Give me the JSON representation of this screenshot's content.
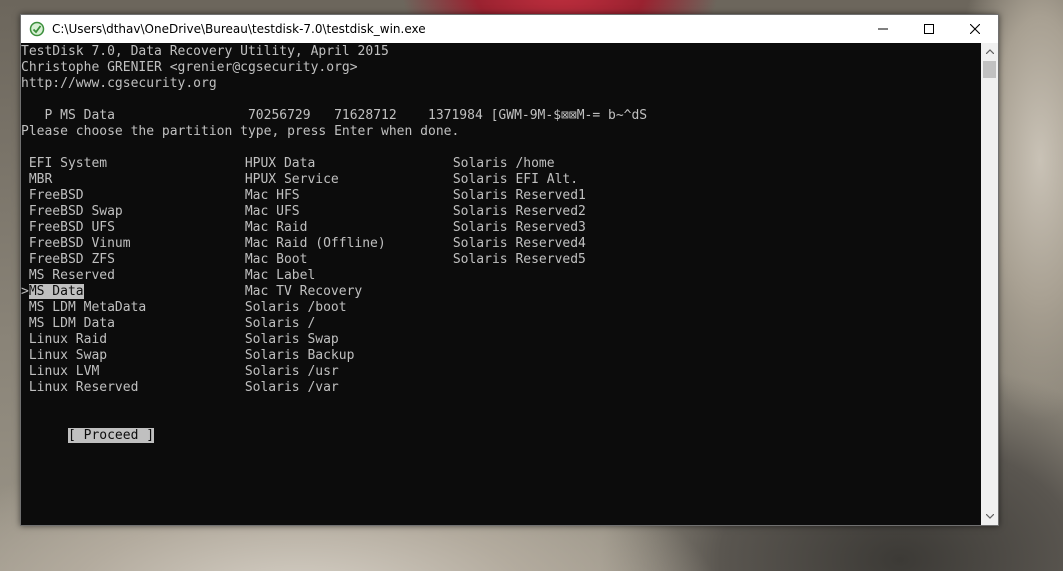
{
  "window": {
    "title": "C:\\Users\\dthav\\OneDrive\\Bureau\\testdisk-7.0\\testdisk_win.exe"
  },
  "console": {
    "header": [
      "TestDisk 7.0, Data Recovery Utility, April 2015",
      "Christophe GRENIER <grenier@cgsecurity.org>",
      "http://www.cgsecurity.org"
    ],
    "partition_line": "   P MS Data                 70256729   71628712    1371984 [GWM-9M-$⊠⊠M-= b~^dS",
    "prompt": "Please choose the partition type, press Enter when done.",
    "types_col1": [
      "EFI System",
      "MBR",
      "FreeBSD",
      "FreeBSD Swap",
      "FreeBSD UFS",
      "FreeBSD Vinum",
      "FreeBSD ZFS",
      "MS Reserved",
      "MS Data",
      "MS LDM MetaData",
      "MS LDM Data",
      "Linux Raid",
      "Linux Swap",
      "Linux LVM",
      "Linux Reserved"
    ],
    "types_col2": [
      "HPUX Data",
      "HPUX Service",
      "Mac HFS",
      "Mac UFS",
      "Mac Raid",
      "Mac Raid (Offline)",
      "Mac Boot",
      "Mac Label",
      "Mac TV Recovery",
      "Solaris /boot",
      "Solaris /",
      "Solaris Swap",
      "Solaris Backup",
      "Solaris /usr",
      "Solaris /var"
    ],
    "types_col3": [
      "Solaris /home",
      "Solaris EFI Alt.",
      "Solaris Reserved1",
      "Solaris Reserved2",
      "Solaris Reserved3",
      "Solaris Reserved4",
      "Solaris Reserved5"
    ],
    "selected_marker": ">",
    "selected_index": 8,
    "proceed_label": "[ Proceed ]"
  },
  "colors": {
    "console_bg": "#0c0c0c",
    "console_fg": "#c0c0c0",
    "titlebar_bg": "#ffffff"
  },
  "icons": {
    "app": "cmd-app-icon",
    "minimize": "minimize-icon",
    "maximize": "maximize-icon",
    "close": "close-icon",
    "scroll_up": "scroll-up-arrow-icon",
    "scroll_down": "scroll-down-arrow-icon"
  }
}
